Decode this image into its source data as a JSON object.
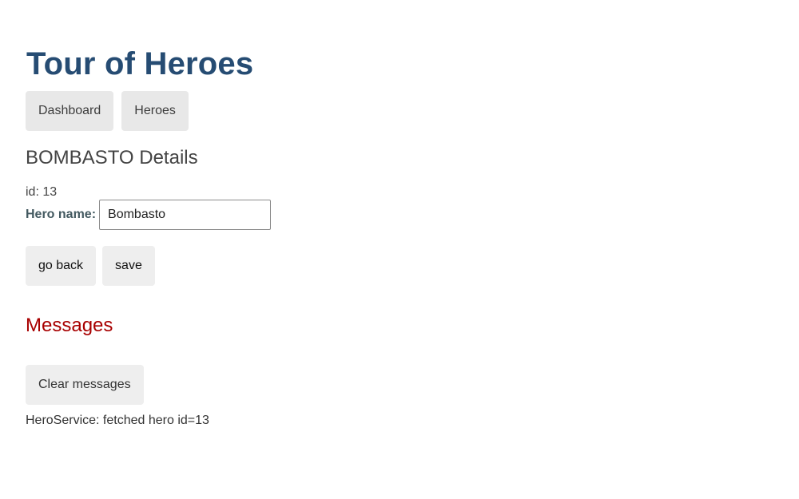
{
  "app": {
    "title": "Tour of Heroes"
  },
  "nav": {
    "items": [
      {
        "label": "Dashboard"
      },
      {
        "label": "Heroes"
      }
    ]
  },
  "hero_detail": {
    "title": "BOMBASTO Details",
    "id_text": "id: 13",
    "name_label": "Hero name:",
    "name_value": "Bombasto",
    "name_placeholder": "",
    "go_back_label": "go back",
    "save_label": "save"
  },
  "messages": {
    "title": "Messages",
    "clear_label": "Clear messages",
    "items": [
      {
        "text": "HeroService: fetched hero id=13"
      }
    ]
  },
  "colors": {
    "title": "#264c73",
    "messages_title": "#a80000",
    "nav_bg": "#e8e8e8",
    "button_bg": "#eeeeee"
  }
}
